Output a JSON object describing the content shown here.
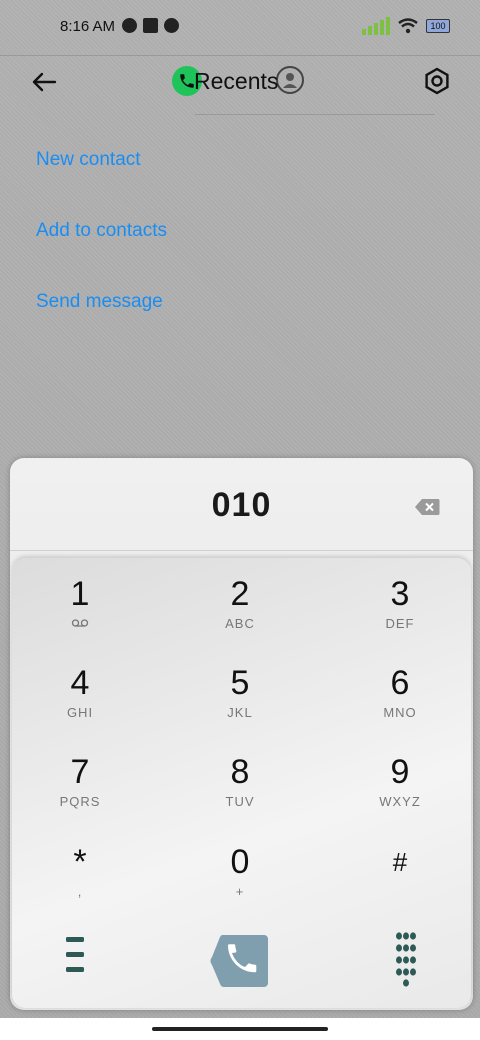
{
  "status": {
    "time": "8:16 AM",
    "battery": "100"
  },
  "header": {
    "title": "Recents"
  },
  "menu": {
    "new_contact": "New contact",
    "add_to_contacts": "Add to contacts",
    "send_message": "Send message"
  },
  "dialer": {
    "digits": "010",
    "keys": [
      {
        "num": "1",
        "sub": ""
      },
      {
        "num": "2",
        "sub": "ABC"
      },
      {
        "num": "3",
        "sub": "DEF"
      },
      {
        "num": "4",
        "sub": "GHI"
      },
      {
        "num": "5",
        "sub": "JKL"
      },
      {
        "num": "6",
        "sub": "MNO"
      },
      {
        "num": "7",
        "sub": "PQRS"
      },
      {
        "num": "8",
        "sub": "TUV"
      },
      {
        "num": "9",
        "sub": "WXYZ"
      },
      {
        "num": "*",
        "sub": ","
      },
      {
        "num": "0",
        "sub": "+"
      },
      {
        "num": "#",
        "sub": ""
      }
    ]
  },
  "colors": {
    "link": "#1a8df2",
    "call_button": "#7f9eae",
    "phone_badge": "#1ec45a",
    "signal": "#7cc142"
  },
  "icons": [
    "back-arrow-icon",
    "settings-icon",
    "phone-icon",
    "person-icon",
    "voicemail-icon",
    "backspace-icon",
    "menu-icon",
    "call-icon",
    "dialpad-icon",
    "wifi-icon",
    "signal-icon",
    "battery-icon"
  ]
}
